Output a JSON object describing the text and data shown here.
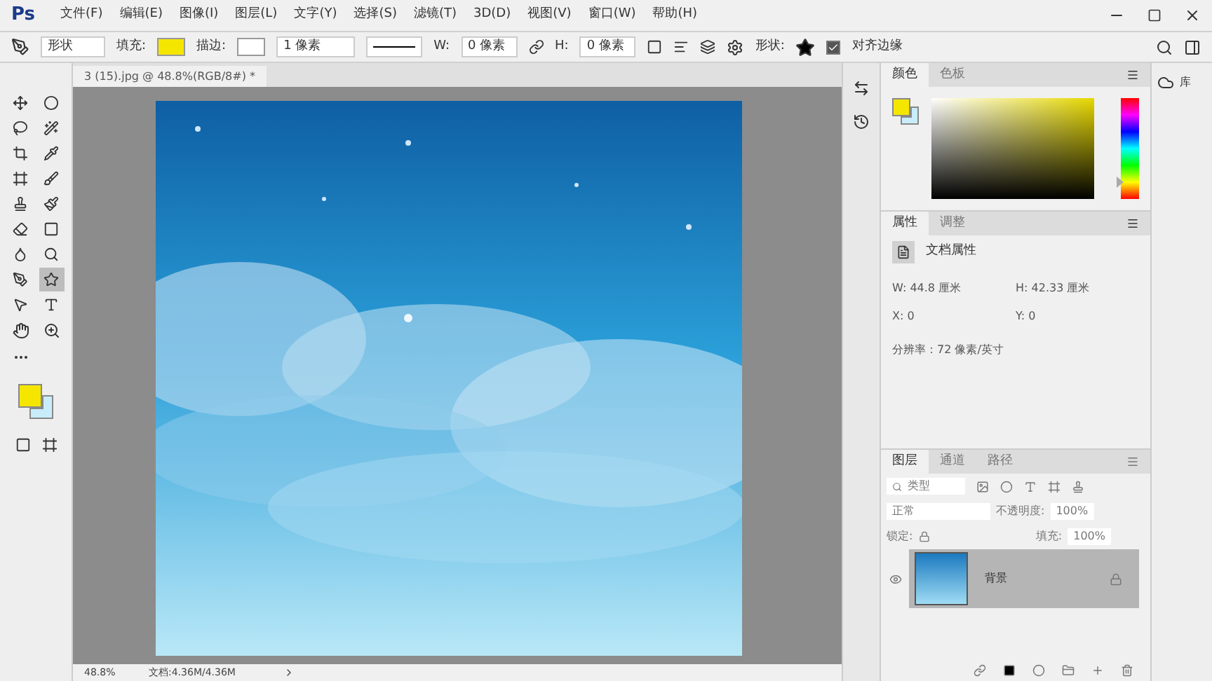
{
  "app_logo": "Ps",
  "menu": [
    "文件(F)",
    "编辑(E)",
    "图像(I)",
    "图层(L)",
    "文字(Y)",
    "选择(S)",
    "滤镜(T)",
    "3D(D)",
    "视图(V)",
    "窗口(W)",
    "帮助(H)"
  ],
  "options": {
    "mode": "形状",
    "fill_label": "填充:",
    "stroke_label": "描边:",
    "stroke_width": "1 像素",
    "w_label": "W:",
    "w_value": "0 像素",
    "h_label": "H:",
    "h_value": "0 像素",
    "shape_label": "形状:",
    "align_edges": {
      "label": "对齐边缘",
      "checked": true
    }
  },
  "document": {
    "tab": "3 (15).jpg @ 48.8%(RGB/8#) *",
    "zoom": "48.8%",
    "doc_size": "文档:4.36M/4.36M"
  },
  "tools": [
    {
      "selected": false
    },
    {
      "selected": false
    },
    {
      "selected": false
    },
    {
      "selected": false
    },
    {
      "selected": false
    },
    {
      "selected": false
    },
    {
      "selected": false
    },
    {
      "selected": false
    },
    {
      "selected": false
    },
    {
      "selected": false
    },
    {
      "selected": false
    },
    {
      "selected": false
    },
    {
      "selected": false
    },
    {
      "selected": false
    },
    {
      "selected": false
    },
    {
      "selected": true
    },
    {
      "selected": false
    },
    {
      "selected": false
    }
  ],
  "color_panel": {
    "tabs": [
      {
        "label": "颜色",
        "selected": true
      },
      {
        "label": "色板",
        "selected": false
      }
    ],
    "hue_slider": {
      "level": 0.16
    }
  },
  "properties": {
    "tabs": [
      {
        "label": "属性",
        "selected": true
      },
      {
        "label": "调整",
        "selected": false
      }
    ],
    "header": "文档属性",
    "fields": [
      {
        "label": "W:",
        "value": "44.8 厘米"
      },
      {
        "label": "H:",
        "value": "42.33 厘米"
      },
      {
        "label": "X:",
        "value": "0"
      },
      {
        "label": "Y:",
        "value": "0"
      }
    ],
    "resolution": "分辨率：72 像素/英寸"
  },
  "layers_panel": {
    "tabs": [
      {
        "label": "图层",
        "selected": true
      },
      {
        "label": "通道",
        "selected": false
      },
      {
        "label": "路径",
        "selected": false
      }
    ],
    "filter": "类型",
    "blend": "正常",
    "opacity_label": "不透明度:",
    "opacity": "100%",
    "lock_label": "锁定:",
    "fill_label": "填充:",
    "fill": "100%",
    "layers": [
      {
        "name": "背景",
        "visible": true,
        "selected": true,
        "locked": true
      }
    ]
  },
  "library": "库"
}
